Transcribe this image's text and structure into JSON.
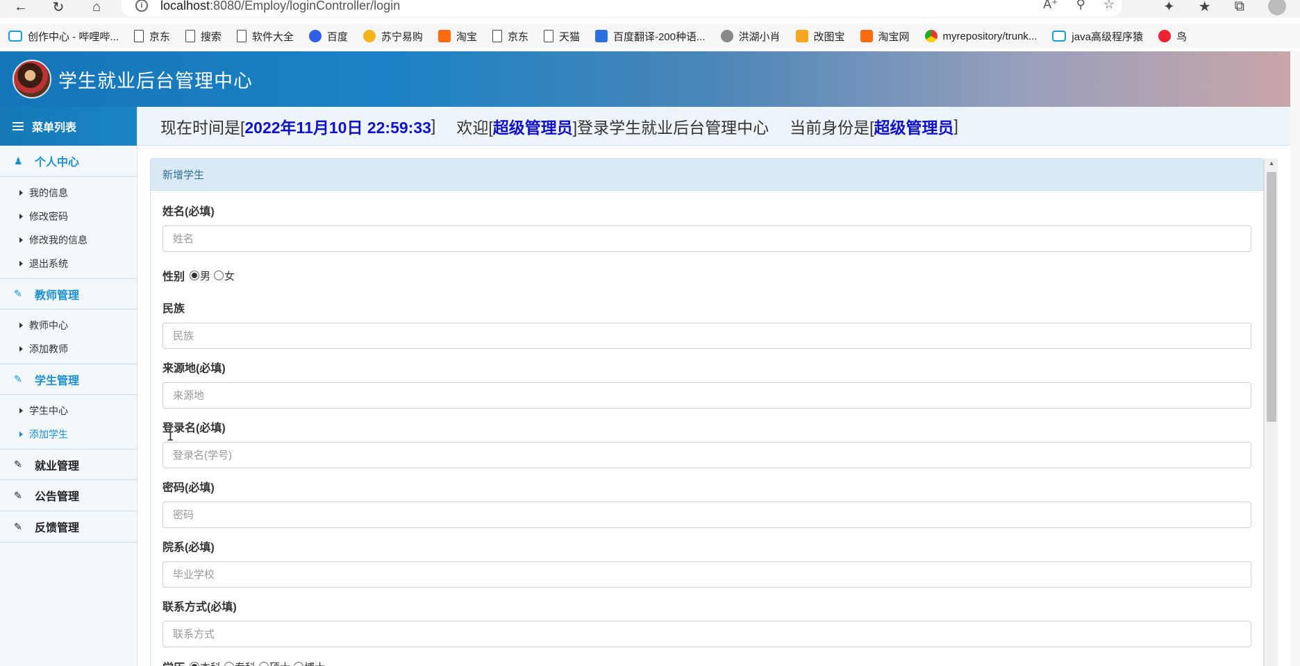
{
  "browser": {
    "url_host": "localhost",
    "url_rest": ":8080/Employ/loginController/login",
    "bookmarks": [
      {
        "label": "创作中心 - 哔哩哔...",
        "icon": "bilibili-icon"
      },
      {
        "label": "京东",
        "icon": "page-icon"
      },
      {
        "label": "搜索",
        "icon": "page-icon"
      },
      {
        "label": "软件大全",
        "icon": "page-icon"
      },
      {
        "label": "百度",
        "icon": "baidu-icon"
      },
      {
        "label": "苏宁易购",
        "icon": "suning-icon"
      },
      {
        "label": "淘宝",
        "icon": "taobao-icon"
      },
      {
        "label": "京东",
        "icon": "page-icon"
      },
      {
        "label": "天猫",
        "icon": "page-icon"
      },
      {
        "label": "百度翻译-200种语...",
        "icon": "translate-icon"
      },
      {
        "label": "洪湖小肖",
        "icon": "hawk-icon"
      },
      {
        "label": "改图宝",
        "icon": "gaitubao-icon"
      },
      {
        "label": "淘宝网",
        "icon": "taobao-icon"
      },
      {
        "label": "myrepository/trunk...",
        "icon": "chrome-icon"
      },
      {
        "label": "java高级程序猿",
        "icon": "bilibili-icon"
      },
      {
        "label": "鸟",
        "icon": "bird-icon"
      }
    ]
  },
  "header": {
    "title": "学生就业后台管理中心"
  },
  "sidebar": {
    "menu_title": "菜单列表",
    "groups": [
      {
        "label": "个人中心",
        "items": [
          "我的信息",
          "修改密码",
          "修改我的信息",
          "退出系统"
        ]
      },
      {
        "label": "教师管理",
        "items": [
          "教师中心",
          "添加教师"
        ]
      },
      {
        "label": "学生管理",
        "items": [
          "学生中心",
          "添加学生"
        ]
      },
      {
        "label": "就业管理",
        "items": []
      },
      {
        "label": "公告管理",
        "items": []
      },
      {
        "label": "反馈管理",
        "items": []
      }
    ]
  },
  "status": {
    "time_prefix": "现在时间是[",
    "time_value": "2022年11月10日 22:59:33",
    "time_suffix": "]",
    "welcome_prefix": "欢迎[",
    "welcome_user": "超级管理员",
    "welcome_suffix": "]登录学生就业后台管理中心",
    "role_prefix": "当前身份是[",
    "role_value": "超级管理员",
    "role_suffix": "]"
  },
  "form": {
    "panel_title": "新增学生",
    "name_label": "姓名(必填)",
    "name_placeholder": "姓名",
    "gender_label": "性别",
    "gender_options": [
      "男",
      "女"
    ],
    "nation_label": "民族",
    "nation_placeholder": "民族",
    "origin_label": "来源地(必填)",
    "origin_placeholder": "来源地",
    "login_label": "登录名(必填)",
    "login_placeholder": "登录名(学号)",
    "password_label": "密码(必填)",
    "password_placeholder": "密码",
    "dept_label": "院系(必填)",
    "dept_placeholder": "毕业学校",
    "contact_label": "联系方式(必填)",
    "contact_placeholder": "联系方式",
    "edu_label": "学历",
    "edu_options": [
      "本科",
      "专科",
      "硕士",
      "博士"
    ]
  },
  "colors": {
    "accent": "#1a8fd0",
    "highlight": "#1010c8",
    "panel_head": "#d9eaf5"
  }
}
